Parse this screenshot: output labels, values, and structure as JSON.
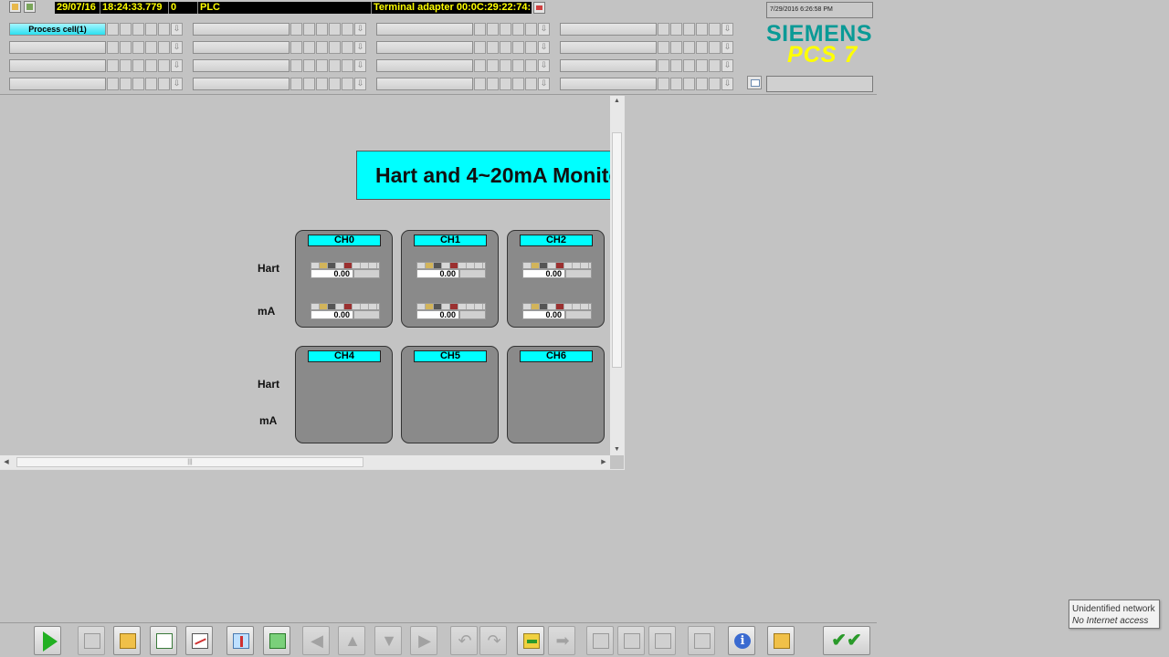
{
  "header": {
    "message_line": {
      "date": "29/07/16",
      "time": "18:24:33.779",
      "number": "0",
      "source": "PLC",
      "text": "Terminal adapter 00:0C:29:22:74:"
    },
    "area_buttons": [
      [
        "Process cell(1)",
        "",
        "",
        ""
      ],
      [
        "",
        "",
        "",
        ""
      ],
      [
        "",
        "",
        "",
        ""
      ],
      [
        "",
        "",
        "",
        ""
      ]
    ],
    "clock": "7/29/2016 6:26:58 PM",
    "logo_brand": "SIEMENS",
    "logo_product": "PCS 7",
    "colors": {
      "message_bg": "#000000",
      "message_text": "#ffff00",
      "active_area": "#2adfef",
      "siemens_teal": "#0a9a96",
      "pcs7_yellow": "#ffff00"
    }
  },
  "picture": {
    "title": "Hart and 4~20mA Monito",
    "row_labels": {
      "hart": "Hart",
      "ma": "mA"
    },
    "channels_top": [
      {
        "name": "CH0",
        "hart_value": "0.00",
        "ma_value": "0.00"
      },
      {
        "name": "CH1",
        "hart_value": "0.00",
        "ma_value": "0.00"
      },
      {
        "name": "CH2",
        "hart_value": "0.00",
        "ma_value": "0.00"
      }
    ],
    "channels_bottom": [
      {
        "name": "CH4"
      },
      {
        "name": "CH5"
      },
      {
        "name": "CH6"
      }
    ],
    "colors": {
      "title_bg": "#00ffff",
      "panel_bg": "#8a8a8a"
    }
  },
  "toolbar": {
    "icons": [
      "play-icon",
      "key-icon",
      "new-picture-icon",
      "alarm-list-icon",
      "trend-icon",
      "temperature-icon",
      "switch-icon",
      "arrow-left-icon",
      "arrow-up-icon",
      "arrow-down-icon",
      "arrow-right-icon",
      "undo-icon",
      "redo-icon",
      "goto-icon",
      "next-icon",
      "window-stack-icon",
      "window-save-icon",
      "window-close-icon",
      "monitor-view-icon",
      "info-icon",
      "horn-icon",
      "acknowledge-icon"
    ]
  },
  "network": {
    "title": "Unidentified network",
    "status": "No Internet access"
  }
}
